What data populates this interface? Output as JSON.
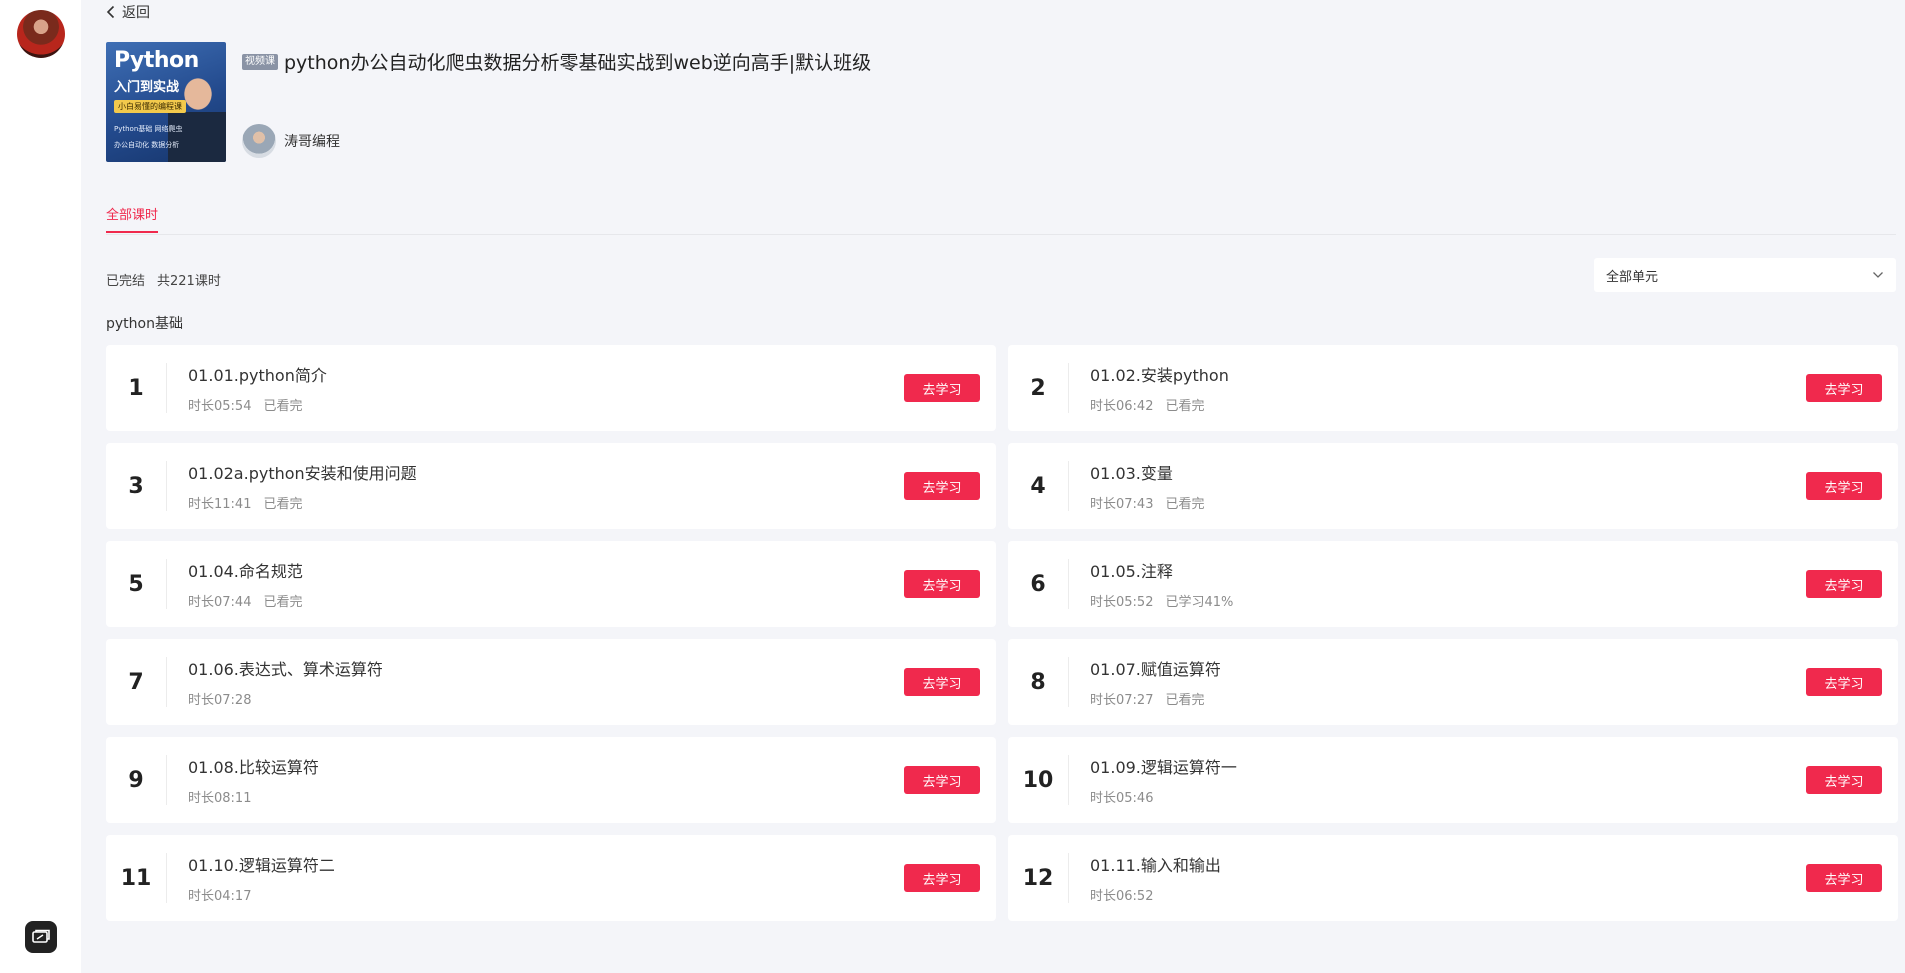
{
  "header": {
    "back_label": "返回",
    "badge": "视频课",
    "title": "python办公自动化爬虫数据分析零基础实战到web逆向高手|默认班级",
    "author_name": "涛哥编程"
  },
  "cover": {
    "title": "Python",
    "subtitle": "入门到实战",
    "tag": "小白易懂的编程课",
    "line1": "Python基础  网络爬虫",
    "line2": "办公自动化  数据分析"
  },
  "tabs": {
    "active_label": "全部课时"
  },
  "status": {
    "state": "已完结",
    "total": "共221课时"
  },
  "unit_select": {
    "selected": "全部单元"
  },
  "section": {
    "title": "python基础"
  },
  "study_label": "去学习",
  "lessons": [
    {
      "num": "1",
      "title": "01.01.python简介",
      "duration": "时长05:54",
      "progress": "已看完"
    },
    {
      "num": "2",
      "title": "01.02.安装python",
      "duration": "时长06:42",
      "progress": "已看完"
    },
    {
      "num": "3",
      "title": "01.02a.python安装和使用问题",
      "duration": "时长11:41",
      "progress": "已看完"
    },
    {
      "num": "4",
      "title": "01.03.变量",
      "duration": "时长07:43",
      "progress": "已看完"
    },
    {
      "num": "5",
      "title": "01.04.命名规范",
      "duration": "时长07:44",
      "progress": "已看完"
    },
    {
      "num": "6",
      "title": "01.05.注释",
      "duration": "时长05:52",
      "progress": "已学习41%"
    },
    {
      "num": "7",
      "title": "01.06.表达式、算术运算符",
      "duration": "时长07:28",
      "progress": ""
    },
    {
      "num": "8",
      "title": "01.07.赋值运算符",
      "duration": "时长07:27",
      "progress": "已看完"
    },
    {
      "num": "9",
      "title": "01.08.比较运算符",
      "duration": "时长08:11",
      "progress": ""
    },
    {
      "num": "10",
      "title": "01.09.逻辑运算符一",
      "duration": "时长05:46",
      "progress": ""
    },
    {
      "num": "11",
      "title": "01.10.逻辑运算符二",
      "duration": "时长04:17",
      "progress": ""
    },
    {
      "num": "12",
      "title": "01.11.输入和输出",
      "duration": "时长06:52",
      "progress": ""
    }
  ],
  "colors": {
    "accent": "#f0294d",
    "background": "#f4f5f9"
  }
}
